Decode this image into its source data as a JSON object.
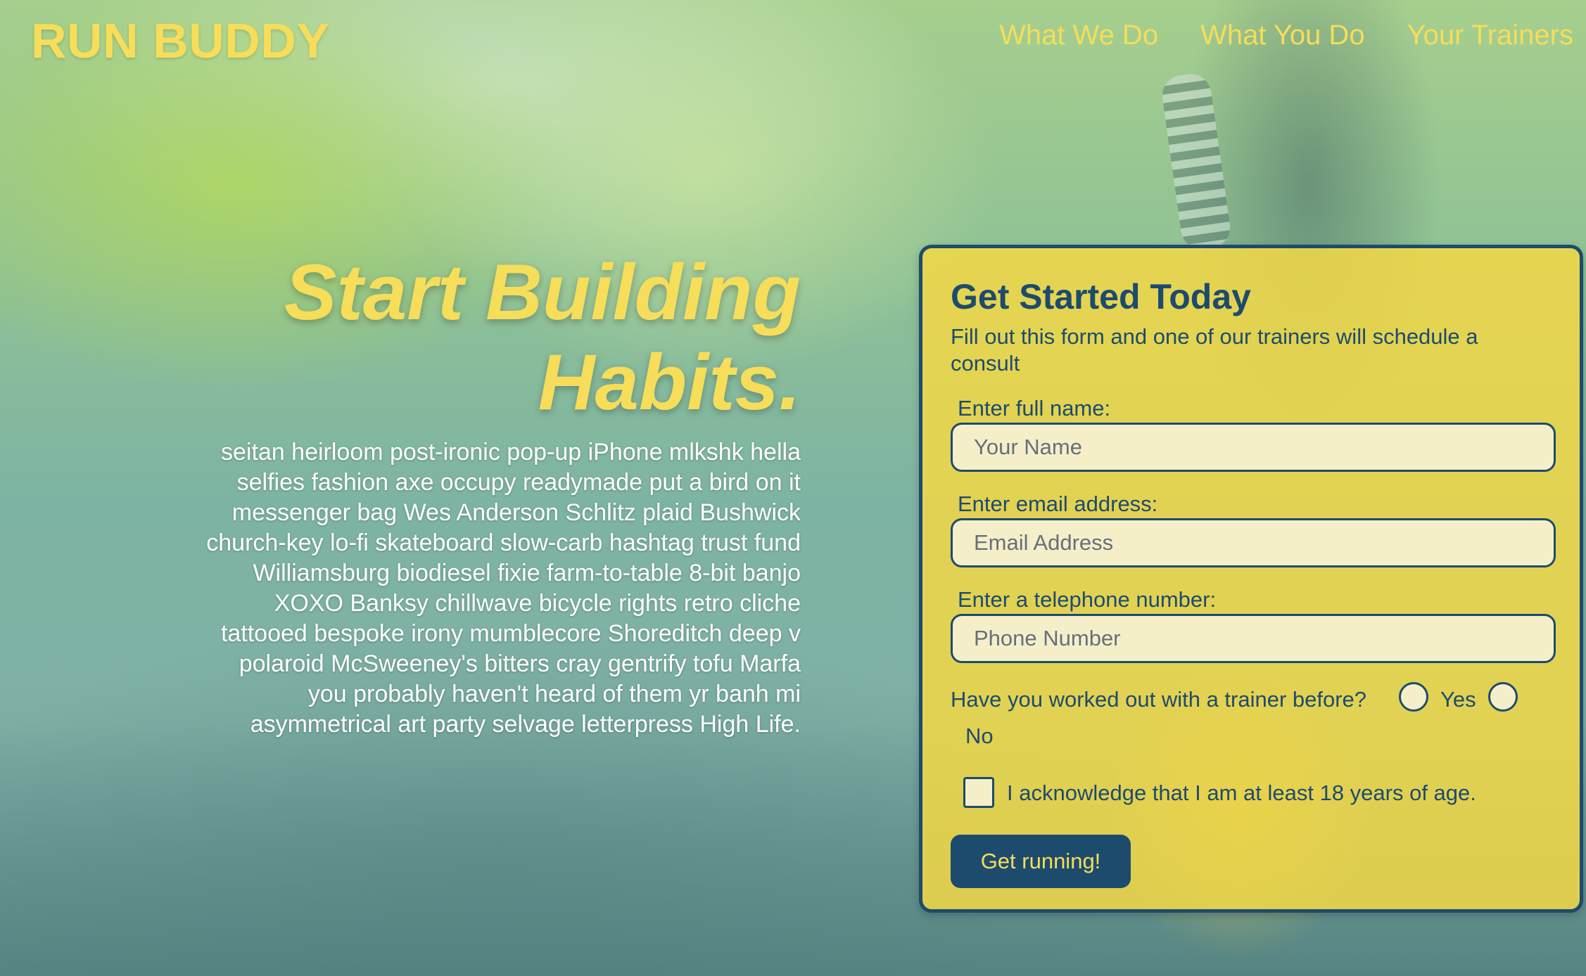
{
  "header": {
    "logo": "RUN BUDDY",
    "nav": [
      {
        "label": "What We Do"
      },
      {
        "label": "What You Do"
      },
      {
        "label": "Your Trainers"
      }
    ]
  },
  "hero": {
    "title": "Start Building Habits.",
    "text": "seitan heirloom post-ironic pop-up iPhone mlkshk hella selfies fashion axe occupy readymade put a bird on it messenger bag Wes Anderson Schlitz plaid Bushwick church-key lo-fi skateboard slow-carb hashtag trust fund Williamsburg biodiesel fixie farm-to-table 8-bit banjo XOXO Banksy chillwave bicycle rights retro cliche tattooed bespoke irony mumblecore Shoreditch deep v polaroid McSweeney's bitters cray gentrify tofu Marfa you probably haven't heard of them yr banh mi asymmetrical art party selvage letterpress High Life."
  },
  "form": {
    "title": "Get Started Today",
    "subtitle": "Fill out this form and one of our trainers will schedule a consult",
    "name_label": "Enter full name:",
    "name_placeholder": "Your Name",
    "email_label": "Enter email address:",
    "email_placeholder": "Email Address",
    "phone_label": "Enter a telephone number:",
    "phone_placeholder": "Phone Number",
    "trainer_question": "Have you worked out with a trainer before?",
    "yes_label": "Yes",
    "no_label": "No",
    "age_ack": "I acknowledge that I am at least 18 years of age.",
    "submit_label": "Get running!"
  },
  "colors": {
    "brand_yellow": "#f6dd5a",
    "brand_navy": "#1d4b6e",
    "card_background": "#f2d746",
    "input_background": "#f5efc9"
  }
}
